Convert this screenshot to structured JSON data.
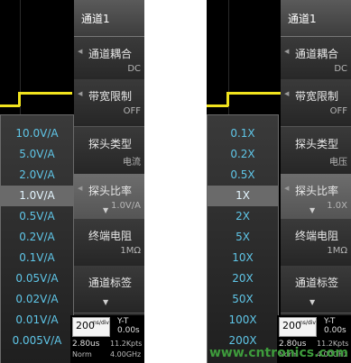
{
  "left": {
    "menu": {
      "title": "通道1",
      "items": [
        {
          "label": "通道耦合",
          "value": "DC"
        },
        {
          "label": "带宽限制",
          "value": "OFF"
        },
        {
          "label": "探头类型",
          "value": "电流"
        },
        {
          "label": "探头比率",
          "value": "1.0V/A"
        },
        {
          "label": "终端电阻",
          "value": "1MΩ"
        },
        {
          "label": "通道标签",
          "value": ""
        }
      ]
    },
    "dropdown": {
      "options": [
        "10.0V/A",
        "5.0V/A",
        "2.0V/A",
        "1.0V/A",
        "0.5V/A",
        "0.2V/A",
        "0.1V/A",
        "0.05V/A",
        "0.02V/A",
        "0.01V/A",
        "0.005V/A"
      ],
      "selected_index": 3
    },
    "status": {
      "timebase": "200",
      "timebase_unit": "ns/div",
      "mode": "Y-T",
      "delay_left": "2.80us",
      "delay_right": "0.00s",
      "trigger": "Norm",
      "points": "11.2Kpts",
      "sample_rate": "4.00GHz"
    }
  },
  "right": {
    "menu": {
      "title": "通道1",
      "items": [
        {
          "label": "通道耦合",
          "value": "DC"
        },
        {
          "label": "带宽限制",
          "value": "OFF"
        },
        {
          "label": "探头类型",
          "value": "电压"
        },
        {
          "label": "探头比率",
          "value": "1.0X"
        },
        {
          "label": "终端电阻",
          "value": "1MΩ"
        },
        {
          "label": "通道标签",
          "value": ""
        }
      ]
    },
    "dropdown": {
      "options": [
        "0.1X",
        "0.2X",
        "0.5X",
        "1X",
        "2X",
        "5X",
        "10X",
        "20X",
        "50X",
        "100X",
        "200X"
      ],
      "selected_index": 3
    },
    "status": {
      "timebase": "200",
      "timebase_unit": "ns/div",
      "mode": "Y-T",
      "delay_left": "2.80us",
      "delay_right": "0.00s",
      "trigger": "Norm",
      "points": "11.2Kpts",
      "sample_rate": "4.00GHz"
    }
  },
  "watermark": "www.cntronics.com",
  "colors": {
    "trace": "#f1e31e",
    "option_text": "#5fc6e8",
    "watermark": "#3e9c3c"
  }
}
